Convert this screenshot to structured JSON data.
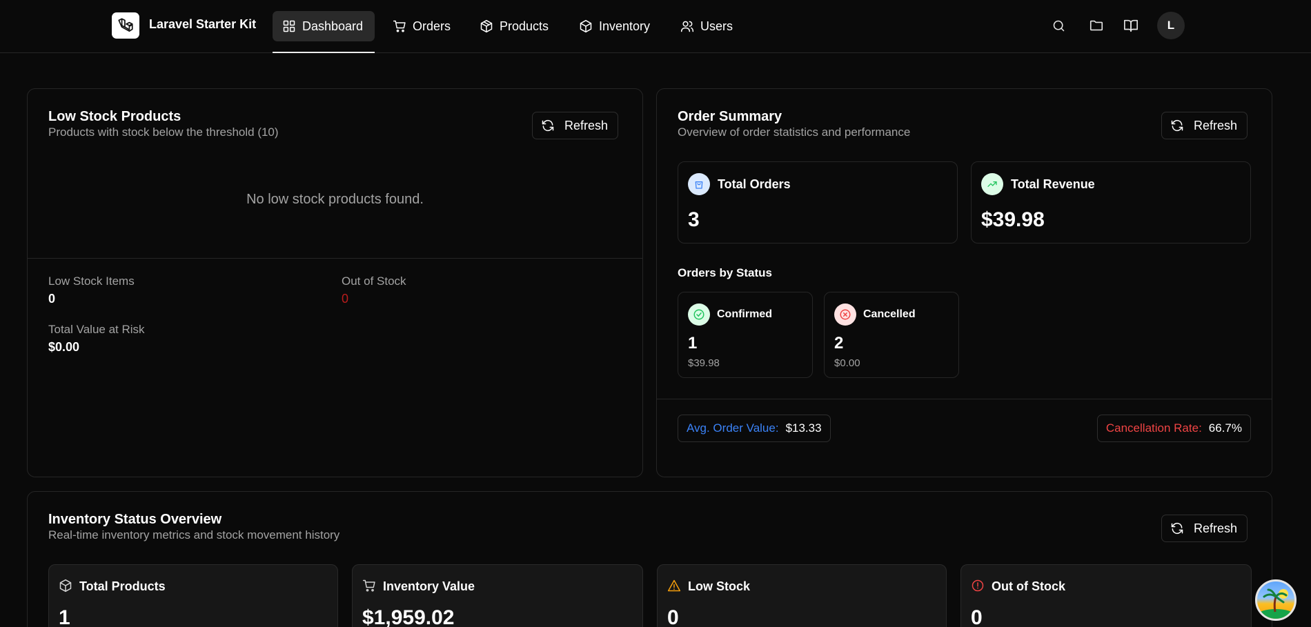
{
  "header": {
    "app_name": "Laravel Starter Kit",
    "nav": [
      {
        "label": "Dashboard",
        "icon": "grid-icon",
        "active": true
      },
      {
        "label": "Orders",
        "icon": "cart-icon"
      },
      {
        "label": "Products",
        "icon": "package-icon"
      },
      {
        "label": "Inventory",
        "icon": "package-icon"
      },
      {
        "label": "Users",
        "icon": "users-icon"
      }
    ],
    "icons": [
      "search-icon",
      "folder-icon",
      "book-icon"
    ],
    "avatar_initial": "L"
  },
  "low_stock": {
    "title": "Low Stock Products",
    "subtitle": "Products with stock below the threshold (10)",
    "refresh_label": "Refresh",
    "empty_message": "No low stock products found.",
    "low_stock_items_label": "Low Stock Items",
    "low_stock_items_value": "0",
    "out_of_stock_label": "Out of Stock",
    "out_of_stock_value": "0",
    "value_at_risk_label": "Total Value at Risk",
    "value_at_risk_value": "$0.00"
  },
  "order_summary": {
    "title": "Order Summary",
    "subtitle": "Overview of order statistics and performance",
    "refresh_label": "Refresh",
    "total_orders_label": "Total Orders",
    "total_orders_value": "3",
    "total_revenue_label": "Total Revenue",
    "total_revenue_value": "$39.98",
    "orders_by_status_label": "Orders by Status",
    "statuses": [
      {
        "label": "Confirmed",
        "count": "1",
        "amount": "$39.98",
        "color": "#22c55e"
      },
      {
        "label": "Cancelled",
        "count": "2",
        "amount": "$0.00",
        "color": "#ef4444"
      }
    ],
    "avg_order_label": "Avg. Order Value:",
    "avg_order_value": "$13.33",
    "cancellation_label": "Cancellation Rate:",
    "cancellation_value": "66.7%"
  },
  "inventory": {
    "title": "Inventory Status Overview",
    "subtitle": "Real-time inventory metrics and stock movement history",
    "refresh_label": "Refresh",
    "metrics": [
      {
        "label": "Total Products",
        "value": "1",
        "icon": "package-icon"
      },
      {
        "label": "Inventory Value",
        "value": "$1,959.02",
        "icon": "cart-icon"
      },
      {
        "label": "Low Stock",
        "value": "0",
        "icon": "warning-icon"
      },
      {
        "label": "Out of Stock",
        "value": "0",
        "icon": "alert-circle-icon"
      }
    ]
  },
  "colors": {
    "blue_accent": "#3b82f6",
    "green_accent": "#22c55e",
    "red_accent": "#ef4444",
    "orange_accent": "#f59e0b"
  }
}
